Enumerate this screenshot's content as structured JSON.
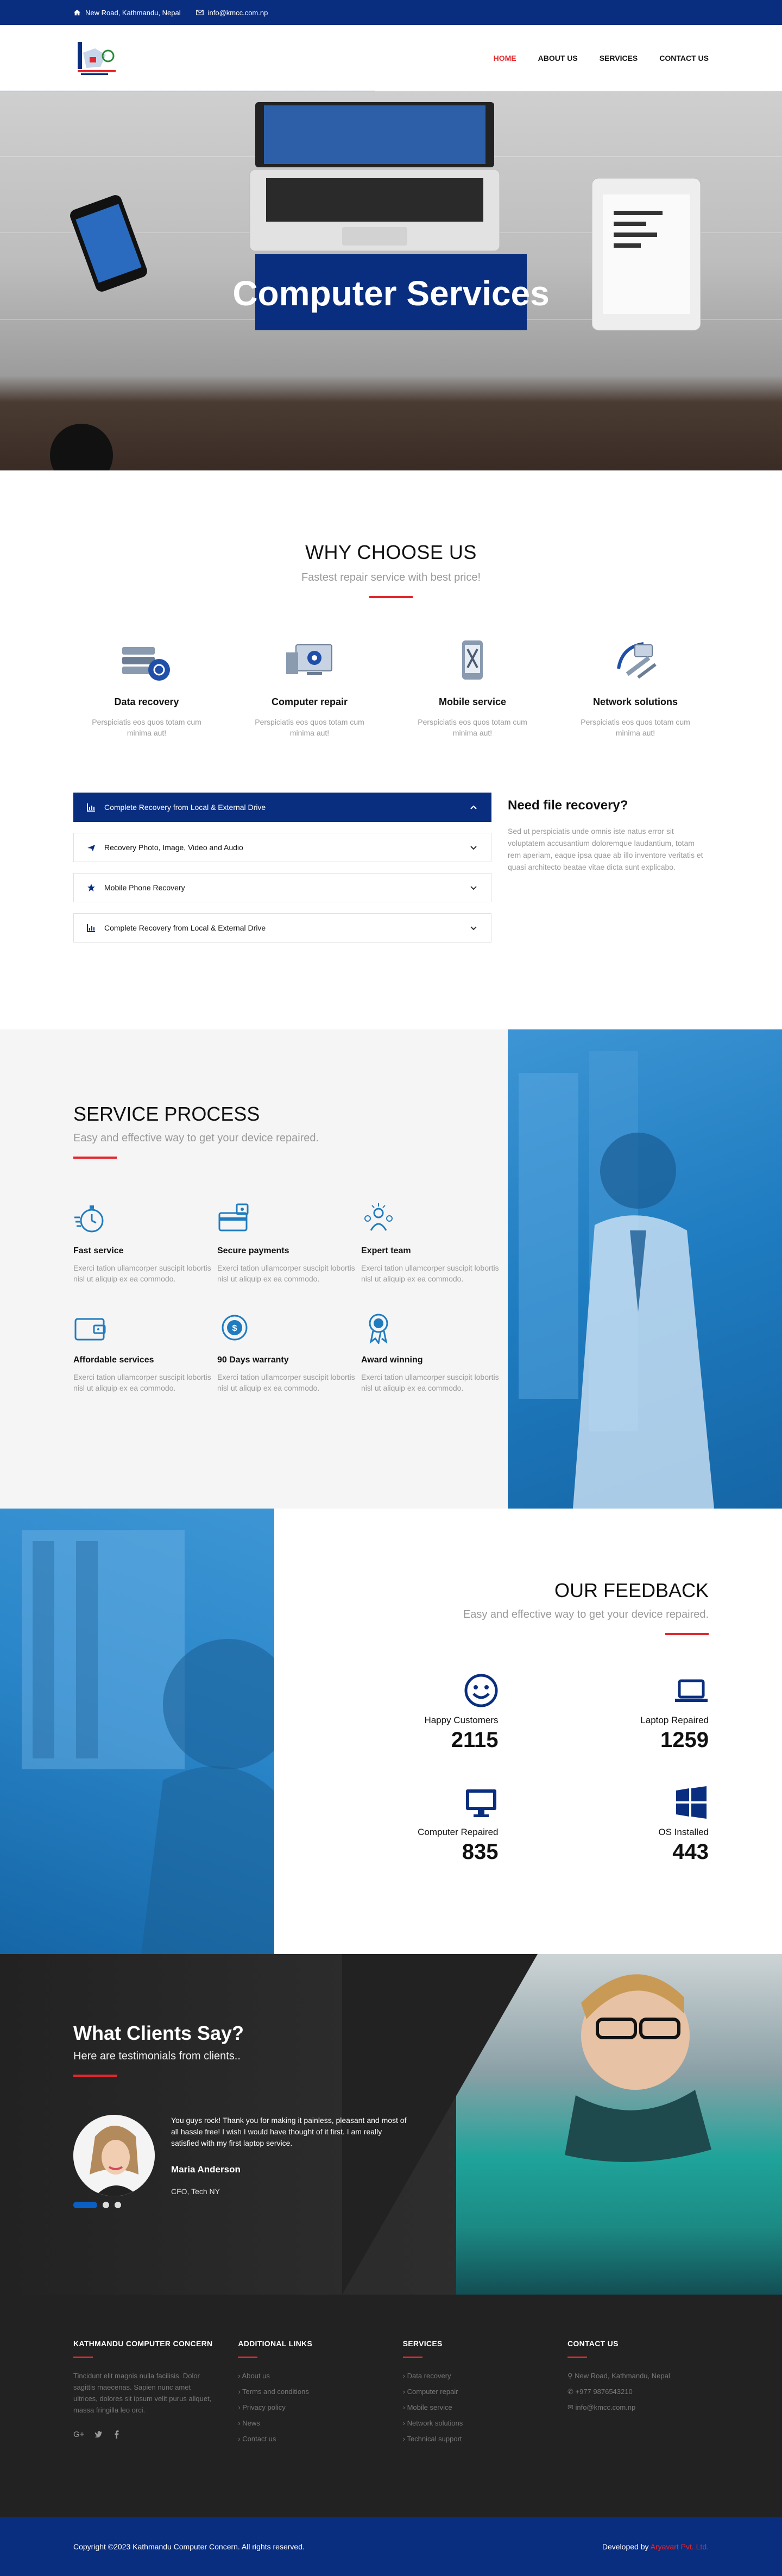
{
  "topbar": {
    "address": "New Road, Kathmandu, Nepal",
    "email": "info@kmcc.com.np"
  },
  "nav": {
    "items": [
      "HOME",
      "ABOUT US",
      "SERVICES",
      "CONTACT US"
    ],
    "active": "HOME"
  },
  "hero": {
    "title": "Computer Services"
  },
  "why": {
    "title": "WHY CHOOSE US",
    "subtitle": "Fastest repair service with best price!",
    "features": [
      {
        "icon": "data-recovery-icon",
        "title": "Data recovery",
        "text": "Perspiciatis eos quos totam cum minima aut!"
      },
      {
        "icon": "computer-repair-icon",
        "title": "Computer repair",
        "text": "Perspiciatis eos quos totam cum minima aut!"
      },
      {
        "icon": "mobile-service-icon",
        "title": "Mobile service",
        "text": "Perspiciatis eos quos totam cum minima aut!"
      },
      {
        "icon": "network-solutions-icon",
        "title": "Network solutions",
        "text": "Perspiciatis eos quos totam cum minima aut!"
      }
    ]
  },
  "accordion": {
    "items": [
      {
        "icon": "chart-icon",
        "label": "Complete Recovery from Local & External Drive",
        "active": true
      },
      {
        "icon": "plane-icon",
        "label": "Recovery Photo, Image, Video and Audio",
        "active": false
      },
      {
        "icon": "star-icon",
        "label": "Mobile Phone Recovery",
        "active": false
      },
      {
        "icon": "chart-icon",
        "label": "Complete Recovery from Local & External Drive",
        "active": false
      }
    ]
  },
  "need": {
    "title": "Need file recovery?",
    "text": "Sed ut perspiciatis unde omnis iste natus error sit voluptatem accusantium doloremque laudantium, totam rem aperiam, eaque ipsa quae ab illo inventore veritatis et quasi architecto beatae vitae dicta sunt explicabo."
  },
  "process": {
    "title": "SERVICE PROCESS",
    "subtitle": "Easy and effective way to get your device repaired.",
    "items": [
      {
        "icon": "stopwatch-icon",
        "title": "Fast service",
        "text": "Exerci tation ullamcorper suscipit lobortis nisl ut aliquip ex ea commodo."
      },
      {
        "icon": "secure-payment-icon",
        "title": "Secure payments",
        "text": "Exerci tation ullamcorper suscipit lobortis nisl ut aliquip ex ea commodo."
      },
      {
        "icon": "expert-team-icon",
        "title": "Expert team",
        "text": "Exerci tation ullamcorper suscipit lobortis nisl ut aliquip ex ea commodo."
      },
      {
        "icon": "wallet-icon",
        "title": "Affordable services",
        "text": "Exerci tation ullamcorper suscipit lobortis nisl ut aliquip ex ea commodo."
      },
      {
        "icon": "warranty-icon",
        "title": "90 Days warranty",
        "text": "Exerci tation ullamcorper suscipit lobortis nisl ut aliquip ex ea commodo."
      },
      {
        "icon": "award-icon",
        "title": "Award winning",
        "text": "Exerci tation ullamcorper suscipit lobortis nisl ut aliquip ex ea commodo."
      }
    ]
  },
  "feedback": {
    "title": "OUR FEEDBACK",
    "subtitle": "Easy and effective way to get your device repaired.",
    "stats": [
      {
        "icon": "smile-icon",
        "name": "Happy Customers",
        "value": "2115"
      },
      {
        "icon": "laptop-icon",
        "name": "Laptop Repaired",
        "value": "1259"
      },
      {
        "icon": "monitor-icon",
        "name": "Computer Repaired",
        "value": "835"
      },
      {
        "icon": "windows-icon",
        "name": "OS Installed",
        "value": "443"
      }
    ]
  },
  "testimonials": {
    "title": "What Clients Say?",
    "subtitle": "Here are testimonials from clients..",
    "quote": "You guys rock! Thank you for making it painless, pleasant and most of all hassle free! I wish I would have thought of it first. I am really satisfied with my first laptop service.",
    "name": "Maria Anderson",
    "role": "CFO, Tech NY",
    "slides": 3,
    "active_slide": 1
  },
  "footer": {
    "about": {
      "title": "KATHMANDU COMPUTER CONCERN",
      "text": "Tincidunt elit magnis nulla facilisis. Dolor sagittis maecenas. Sapien nunc amet ultrices, dolores sit ipsum velit purus aliquet, massa fringilla leo orci.",
      "social": [
        "G+",
        "twitter-icon",
        "facebook-icon"
      ]
    },
    "links": {
      "title": "ADDITIONAL LINKS",
      "items": [
        "› About us",
        "› Terms and conditions",
        "› Privacy policy",
        "› News",
        "› Contact us"
      ]
    },
    "services": {
      "title": "SERVICES",
      "items": [
        "› Data recovery",
        "› Computer repair",
        "› Mobile service",
        "› Network solutions",
        "› Technical support"
      ]
    },
    "contact": {
      "title": "CONTACT US",
      "address": "New Road, Kathmandu, Nepal",
      "phone": "+977 9876543210",
      "email": "info@kmcc.com.np"
    }
  },
  "bottombar": {
    "copyright": "Copyright ©2023 Kathmandu Computer Concern. All rights reserved.",
    "developed_prefix": "Developed by",
    "developer": "Aryavart Pvt. Ltd."
  },
  "colors": {
    "primary": "#0a2e7f",
    "accent": "#e5272d",
    "blue_photo": "#1f7cc0"
  }
}
